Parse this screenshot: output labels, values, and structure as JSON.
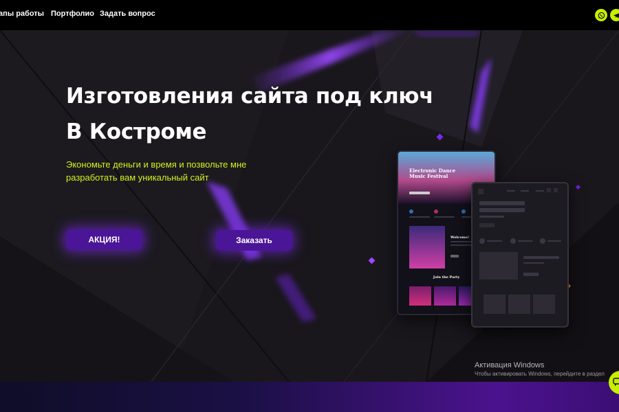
{
  "nav": {
    "items": [
      {
        "label": "апы работы"
      },
      {
        "label": "Портфолио"
      },
      {
        "label": "Задать вопрос"
      }
    ],
    "socials": [
      "whatsapp-icon",
      "telegram-icon"
    ]
  },
  "hero": {
    "title_line1": "Изготовления сайта под ключ",
    "title_line2": "В Костроме",
    "subtitle": "Экономьте деньги и время и позвольте мне разработать вам уникальный сайт",
    "promo_button": "АКЦИЯ!",
    "order_button": "Заказать"
  },
  "mockup": {
    "title": "Electronic Dance Music Festival",
    "welcome": "Welcome!",
    "section": "Join the Party"
  },
  "watermark": {
    "title": "Активация Windows",
    "subtitle": "Чтобы активировать Windows, перейдите в раздел"
  },
  "colors": {
    "accent": "#c6f000",
    "button": "#4a1596",
    "glow": "#7a2ae6",
    "subtitle": "#d4f21c"
  }
}
